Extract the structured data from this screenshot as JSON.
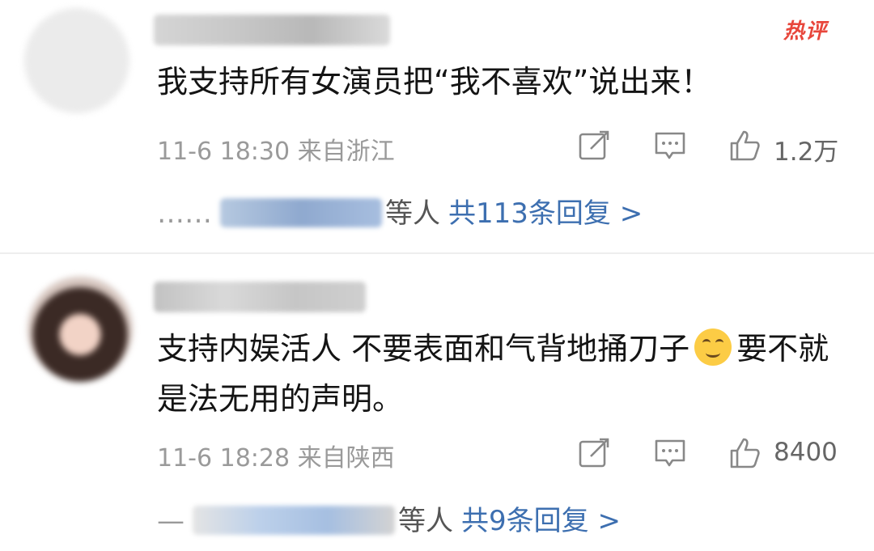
{
  "comments": [
    {
      "badge": "热评",
      "text": "我支持所有女演员把“我不喜欢”说出来！",
      "meta": "11-6 18:30 来自浙江",
      "like_count": "1.2万",
      "replies": {
        "prefix": "……",
        "suffix": "等人",
        "total": "共113条回复 >"
      }
    },
    {
      "text_before_emoji": "支持内娱活人 不要表面和气背地捅刀子",
      "text_after_emoji": "要不就是法无用的声明。",
      "emoji": "smile-emoji",
      "meta": "11-6 18:28 来自陕西",
      "like_count": "8400",
      "replies": {
        "prefix": "—",
        "suffix": "等人",
        "total": "共9条回复 >"
      }
    }
  ],
  "icons": {
    "share": "share-icon",
    "reply": "comment-icon",
    "like": "thumbs-up-icon"
  },
  "colors": {
    "hot_badge": "#e8463b",
    "link": "#3d6fb0",
    "meta": "#9a9a9a"
  }
}
